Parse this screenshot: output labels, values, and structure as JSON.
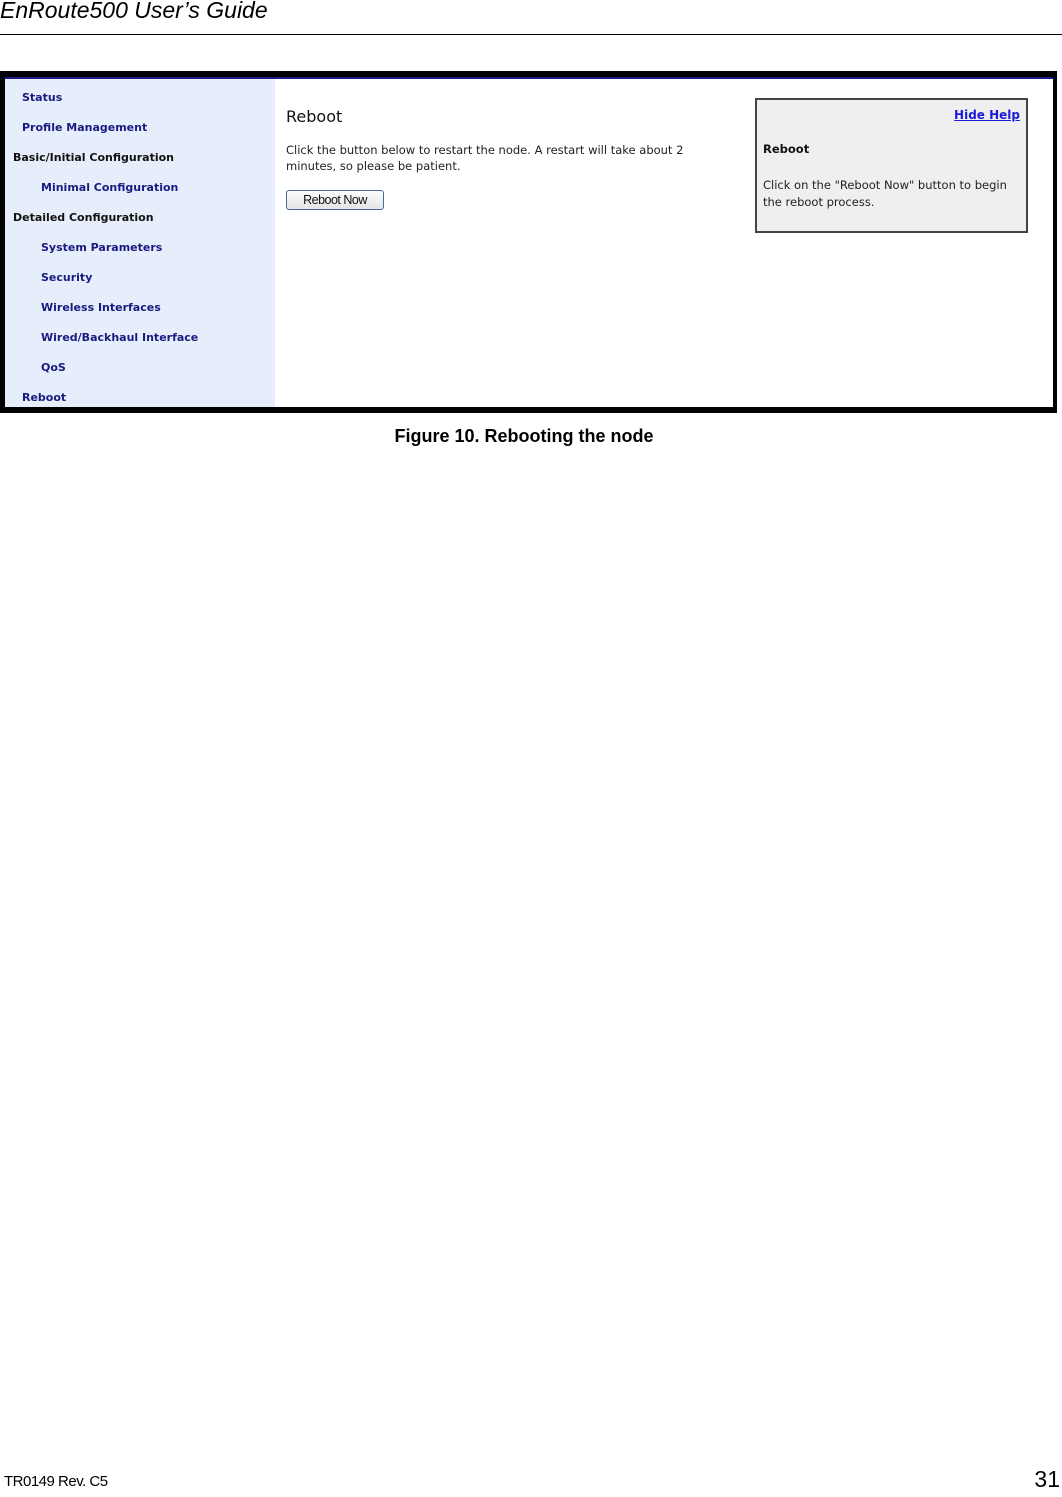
{
  "document": {
    "title": "EnRoute500 User’s Guide",
    "figure_caption": "Figure 10. Rebooting the node",
    "footer_doc_id": "TR0149 Rev. C5",
    "page_number": "31"
  },
  "screenshot": {
    "sidebar": {
      "items": [
        {
          "label": "Status",
          "level": 1,
          "type": "link"
        },
        {
          "label": "Profile Management",
          "level": 1,
          "type": "link"
        },
        {
          "label": "Basic/Initial Configuration",
          "level": 0,
          "type": "header"
        },
        {
          "label": "Minimal Configuration",
          "level": 2,
          "type": "link"
        },
        {
          "label": "Detailed Configuration",
          "level": 0,
          "type": "header"
        },
        {
          "label": "System Parameters",
          "level": 2,
          "type": "link"
        },
        {
          "label": "Security",
          "level": 2,
          "type": "link"
        },
        {
          "label": "Wireless Interfaces",
          "level": 2,
          "type": "link"
        },
        {
          "label": "Wired/Backhaul Interface",
          "level": 2,
          "type": "link"
        },
        {
          "label": "QoS",
          "level": 2,
          "type": "link"
        },
        {
          "label": "Reboot",
          "level": 1,
          "type": "link"
        }
      ]
    },
    "main": {
      "heading": "Reboot",
      "description": "Click the button below to restart the node. A restart will take about 2 minutes, so please be patient.",
      "reboot_button_label": "Reboot Now"
    },
    "help": {
      "hide_help_label": "Hide Help",
      "title": "Reboot",
      "text": "Click on the \"Reboot Now\" button to begin the reboot process."
    },
    "colors": {
      "sidebar_bg": "#e6eefb",
      "nav_link": "#1a1a80",
      "help_link": "#1a1adc",
      "help_bg": "#efefef"
    }
  }
}
